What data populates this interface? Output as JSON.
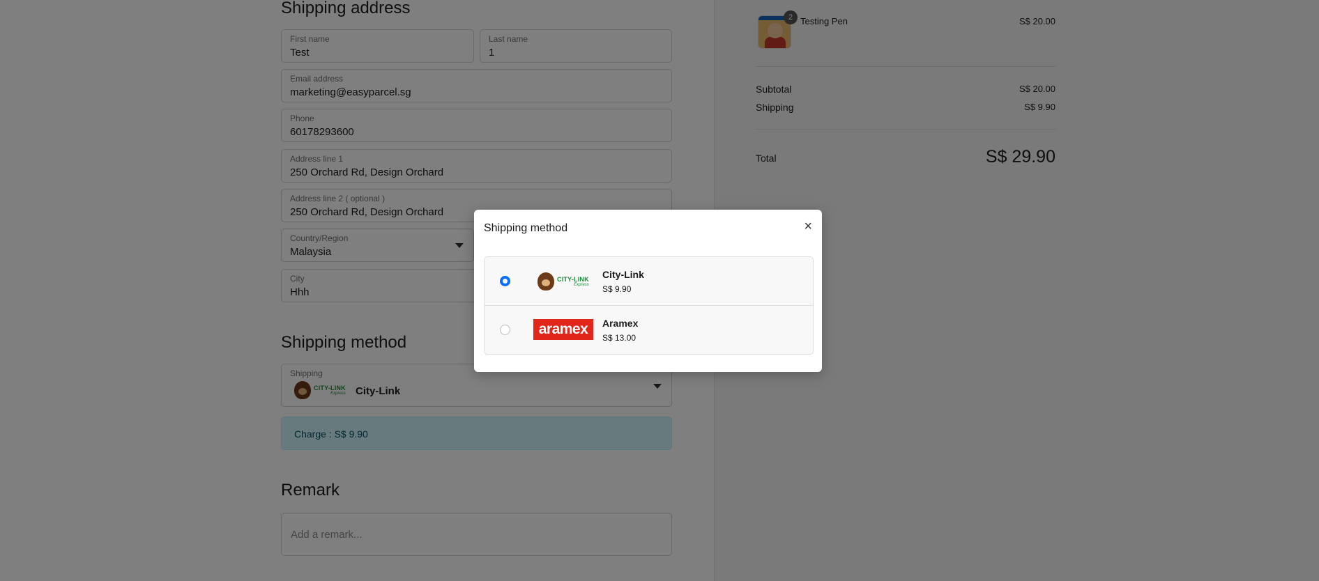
{
  "shipping_address": {
    "title": "Shipping address",
    "first_name": {
      "label": "First name",
      "value": "Test"
    },
    "last_name": {
      "label": "Last name",
      "value": "1"
    },
    "email": {
      "label": "Email address",
      "value": "marketing@easyparcel.sg"
    },
    "phone": {
      "label": "Phone",
      "value": "60178293600"
    },
    "address1": {
      "label": "Address line 1",
      "value": "250 Orchard Rd, Design Orchard"
    },
    "address2": {
      "label": "Address line 2 ( optional )",
      "value": "250 Orchard Rd, Design Orchard"
    },
    "country": {
      "label": "Country/Region",
      "value": "Malaysia"
    },
    "city": {
      "label": "City",
      "value": "Hhh"
    }
  },
  "shipping_method_section": {
    "title": "Shipping method",
    "field_label": "Shipping",
    "selected": "City-Link",
    "charge_text": "Charge : S$ 9.90"
  },
  "remark": {
    "title": "Remark",
    "placeholder": "Add a remark..."
  },
  "summary": {
    "item_name": "Testing Pen",
    "item_qty": "2",
    "item_price": "S$ 20.00",
    "subtotal_label": "Subtotal",
    "subtotal_value": "S$ 20.00",
    "shipping_label": "Shipping",
    "shipping_value": "S$ 9.90",
    "total_label": "Total",
    "total_value": "S$ 29.90"
  },
  "logos": {
    "citylink_main": "CITY-LINK",
    "citylink_sub": "Express",
    "aramex": "aramex"
  },
  "modal": {
    "title": "Shipping method",
    "close": "×",
    "options": [
      {
        "name": "City-Link",
        "price": "S$ 9.90",
        "selected": true
      },
      {
        "name": "Aramex",
        "price": "S$ 13.00",
        "selected": false
      }
    ]
  },
  "colors": {
    "accent": "#0d6efd",
    "charge_bg": "#cff4fc",
    "aramex_red": "#e1251b",
    "citylink_green": "#1c8a3a"
  }
}
